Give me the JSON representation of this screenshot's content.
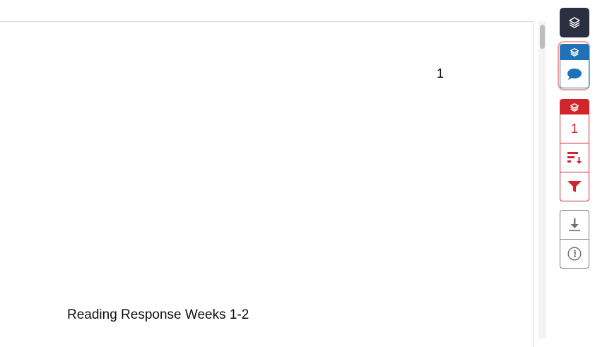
{
  "document": {
    "page_number": "1",
    "title": "Reading Response Weeks 1-2"
  },
  "sidebar": {
    "layers_button": {
      "icon": "layers-icon",
      "color": "#2b2f3f"
    },
    "comments_group": {
      "header_icon": "layers-icon",
      "icon": "comment-icon",
      "color": "#1f72b5",
      "highlight_color": "#f0a39c"
    },
    "issues_group": {
      "header_icon": "layers-icon",
      "count": "1",
      "sort_icon": "sort-icon",
      "filter_icon": "filter-icon",
      "color": "#d0252b"
    },
    "tools_group": {
      "download_icon": "download-icon",
      "info_icon": "info-icon",
      "color": "#7b7b7b"
    }
  }
}
